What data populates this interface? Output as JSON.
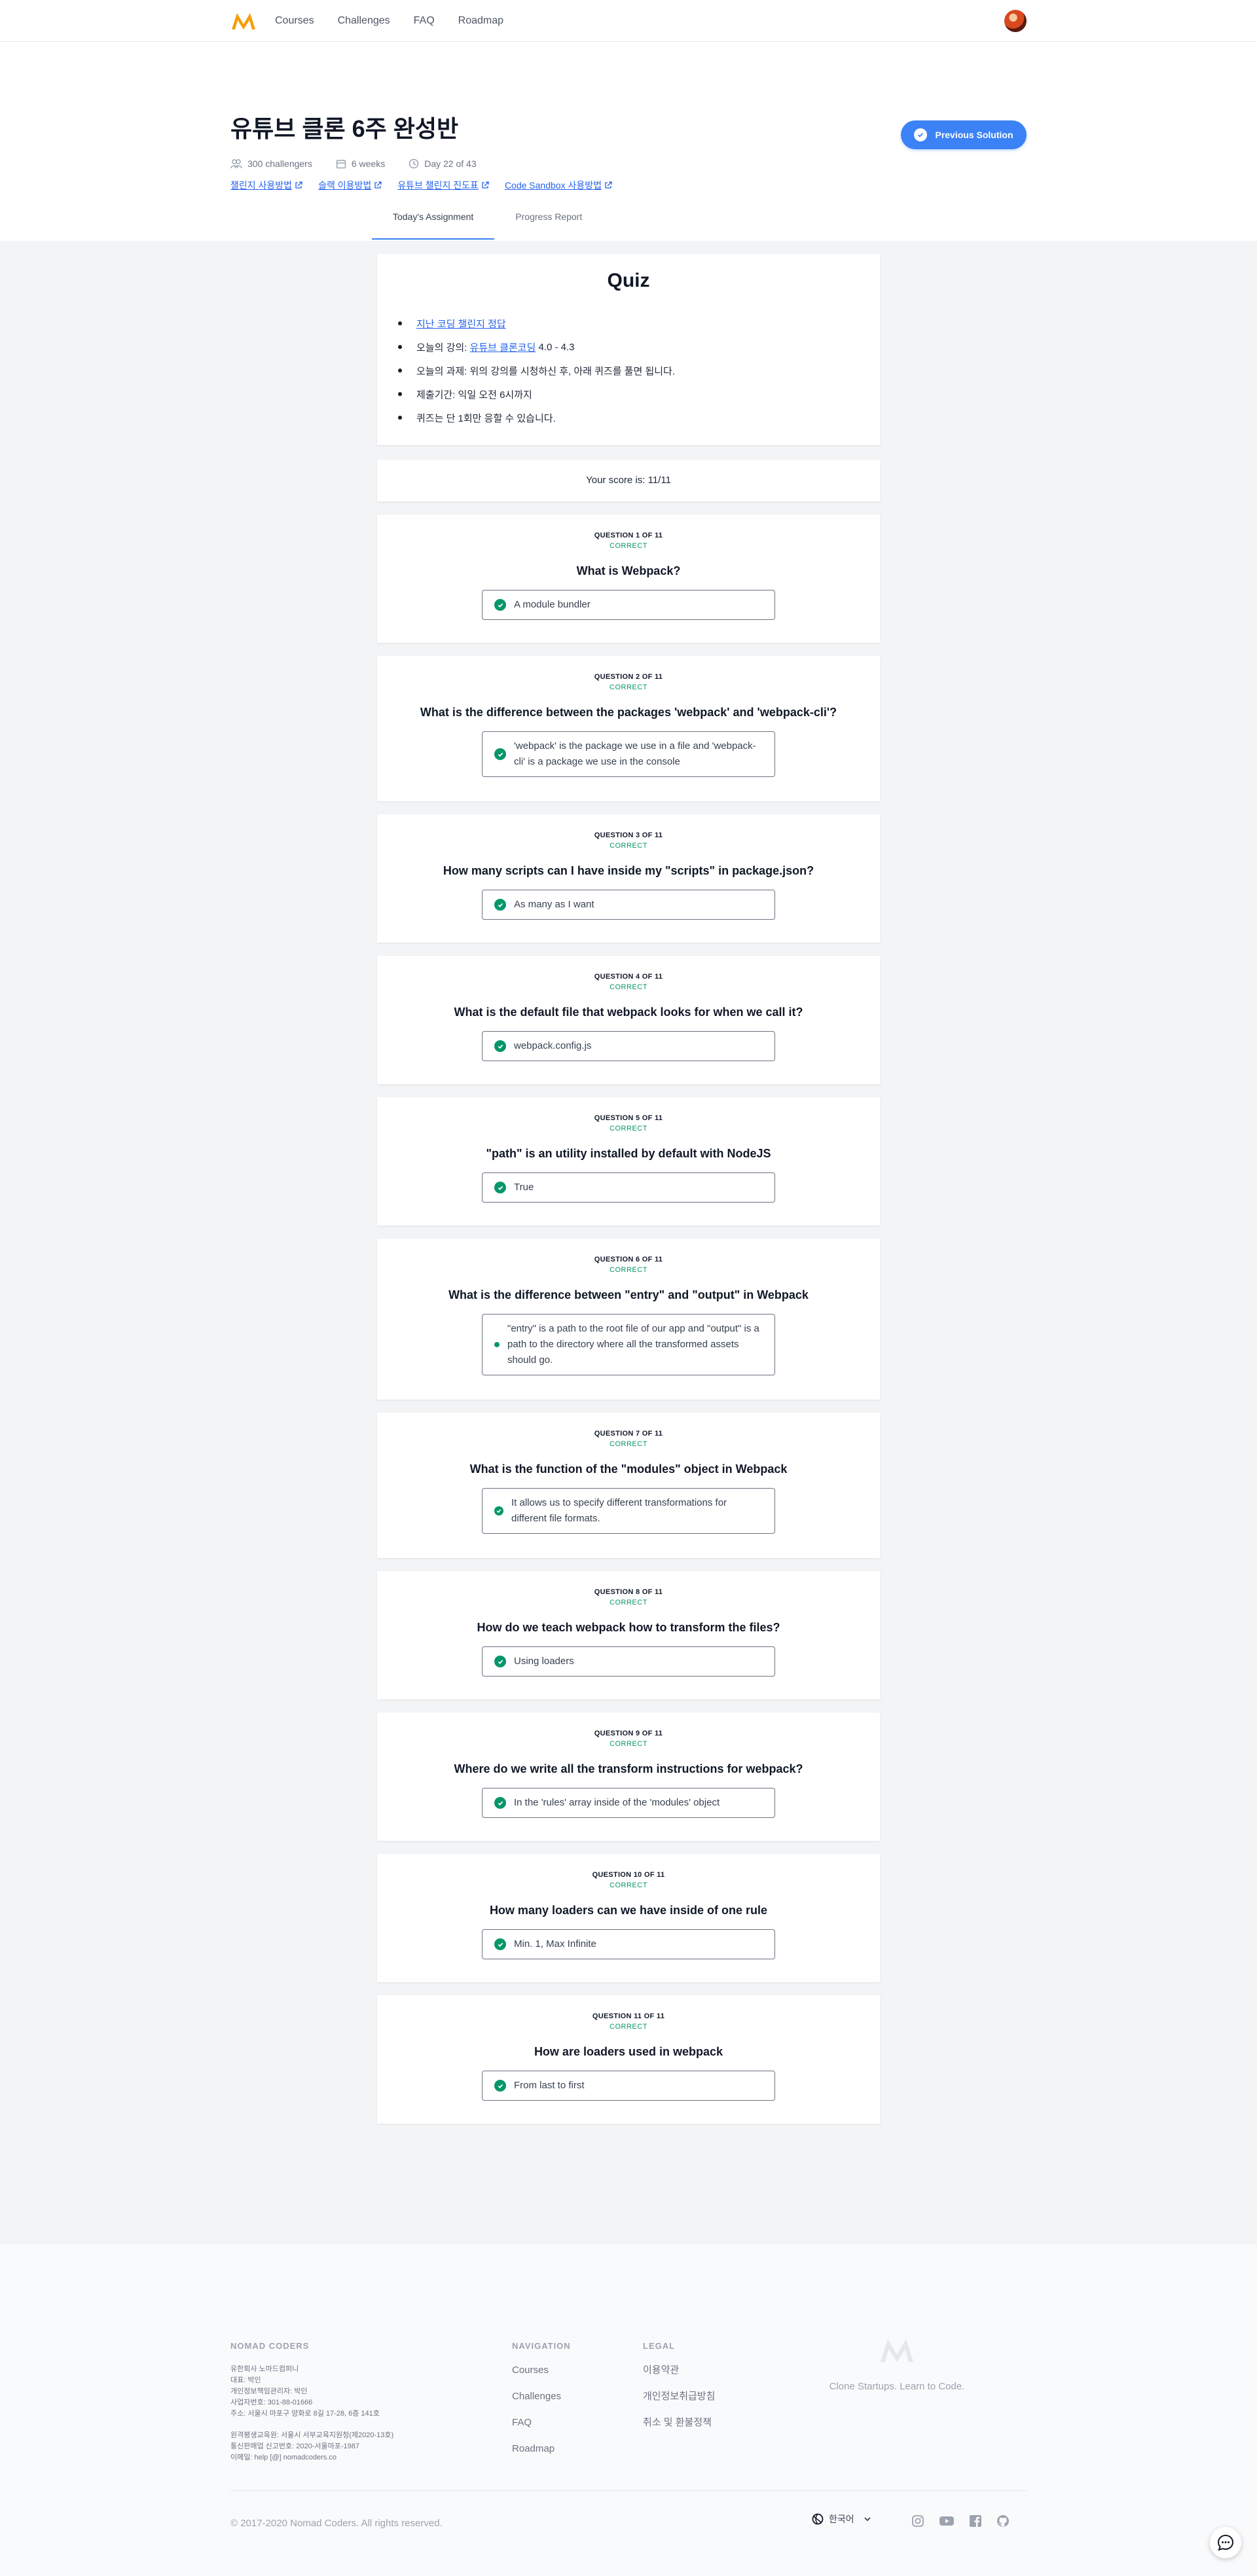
{
  "nav": {
    "links": [
      "Courses",
      "Challenges",
      "FAQ",
      "Roadmap"
    ]
  },
  "header": {
    "title": "유튜브 클론 6주 완성반",
    "challengers": "300 challengers",
    "weeks": "6 weeks",
    "day": "Day 22 of 43",
    "links": [
      "챌린지 사용방법",
      "슬랙 이용방법",
      "유튜브 챌린지 진도표",
      "Code Sandbox 사용방법"
    ],
    "prev_button": "Previous Solution"
  },
  "tabs": [
    "Today's Assignment",
    "Progress Report"
  ],
  "quiz": {
    "title": "Quiz",
    "items": [
      {
        "link": "지난 코딩 챌린지 정답",
        "text": ""
      },
      {
        "prefix": "오늘의 강의: ",
        "link": "유튜브 클론코딩",
        "suffix": " 4.0 - 4.3"
      },
      {
        "text": "오늘의 과제: 위의 강의를 시청하신 후, 아래 퀴즈를 풀면 됩니다."
      },
      {
        "text": "제출기간: 익일 오전 6시까지"
      },
      {
        "text": "퀴즈는 단 1회만 응할 수 있습니다."
      }
    ]
  },
  "score": "Your score is: 11/11",
  "questions": [
    {
      "num": "QUESTION 1 OF 11",
      "status": "CORRECT",
      "question": "What is Webpack?",
      "answer": "A module bundler"
    },
    {
      "num": "QUESTION 2 OF 11",
      "status": "CORRECT",
      "question": "What is the difference between the packages 'webpack' and 'webpack-cli'?",
      "answer": "'webpack' is the package we use in a file and 'webpack-cli' is a package we use in the console"
    },
    {
      "num": "QUESTION 3 OF 11",
      "status": "CORRECT",
      "question": "How many scripts can I have inside my \"scripts\" in package.json?",
      "answer": "As many as I want"
    },
    {
      "num": "QUESTION 4 OF 11",
      "status": "CORRECT",
      "question": "What is the default file that webpack looks for when we call it?",
      "answer": "webpack.config.js"
    },
    {
      "num": "QUESTION 5 OF 11",
      "status": "CORRECT",
      "question": "\"path\" is an utility installed by default with NodeJS",
      "answer": "True"
    },
    {
      "num": "QUESTION 6 OF 11",
      "status": "CORRECT",
      "question": "What is the difference between \"entry\" and \"output\" in Webpack",
      "answer": "\"entry\" is a path to the root file of our app and \"output\" is a path to the directory where all the transformed assets should go."
    },
    {
      "num": "QUESTION 7 OF 11",
      "status": "CORRECT",
      "question": "What is the function of the \"modules\" object in Webpack",
      "answer": "It allows us to specify different transformations for different file formats."
    },
    {
      "num": "QUESTION 8 OF 11",
      "status": "CORRECT",
      "question": "How do we teach webpack how to transform the files?",
      "answer": "Using loaders"
    },
    {
      "num": "QUESTION 9 OF 11",
      "status": "CORRECT",
      "question": "Where do we write all the transform instructions for webpack?",
      "answer": "In the 'rules' array inside of the 'modules' object"
    },
    {
      "num": "QUESTION 10 OF 11",
      "status": "CORRECT",
      "question": "How many loaders can we have inside of one rule",
      "answer": "Min. 1, Max Infinite"
    },
    {
      "num": "QUESTION 11 OF 11",
      "status": "CORRECT",
      "question": "How are loaders used in webpack",
      "answer": "From last to first"
    }
  ],
  "footer": {
    "company_head": "NOMAD CODERS",
    "company_lines": [
      "유한회사 노마드컴퍼니",
      "대표: 박인",
      "개인정보책임관리자: 박인",
      "사업자번호: 301-88-01666",
      "주소: 서울시 마포구 양화로 8길 17-28, 6층 141호"
    ],
    "company_lines2": [
      "원격평생교육원: 서울시 서부교육지원청(제2020-13호)",
      "통신판매업 신고번호: 2020-서울마포-1987",
      "이메일: help [@] nomadcoders.co"
    ],
    "nav_head": "NAVIGATION",
    "nav_links": [
      "Courses",
      "Challenges",
      "FAQ",
      "Roadmap"
    ],
    "legal_head": "LEGAL",
    "legal_links": [
      "이용약관",
      "개인정보취급방침",
      "취소 및 환불정책"
    ],
    "tagline": "Clone Startups. Learn to Code.",
    "copyright": "© 2017-2020 Nomad Coders. All rights reserved.",
    "language": "한국어"
  },
  "colors": {
    "accent": "#3b82f6",
    "correct": "#059669",
    "logo": "#f59e0b"
  }
}
